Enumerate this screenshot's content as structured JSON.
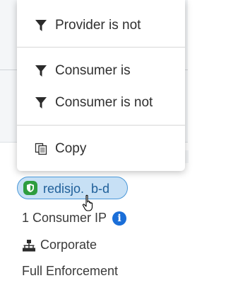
{
  "context_menu": {
    "items": [
      {
        "label": "Provider is not",
        "icon": "filter-icon"
      },
      {
        "label": "Consumer is",
        "icon": "filter-icon"
      },
      {
        "label": "Consumer is not",
        "icon": "filter-icon"
      },
      {
        "label": "Copy",
        "icon": "copy-icon"
      }
    ]
  },
  "chip": {
    "label": "redisjo.  b-d",
    "icon": "shield-icon",
    "accent": "#4a98d8",
    "fill": "#c7e0f5"
  },
  "details": {
    "consumer_ip": "1 Consumer IP",
    "network": "Corporate",
    "enforcement": "Full Enforcement"
  },
  "colors": {
    "info_icon": "#1a6ed8",
    "chip_text": "#1f5f99"
  }
}
